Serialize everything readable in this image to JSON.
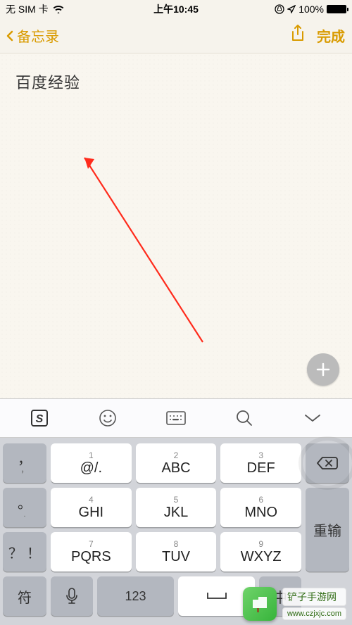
{
  "status": {
    "carrier": "无 SIM 卡",
    "time": "上午10:45",
    "battery": "100%"
  },
  "nav": {
    "back_label": "备忘录",
    "done_label": "完成"
  },
  "note": {
    "content": "百度经验"
  },
  "keyboard": {
    "side_left": {
      "comma": "，",
      "period": "。",
      "question": "？",
      "exclaim": "！"
    },
    "row1": {
      "k1": "@/.",
      "k2": "ABC",
      "k3": "DEF"
    },
    "row2": {
      "k1": "GHI",
      "k2": "JKL",
      "k3": "MNO"
    },
    "row3": {
      "k1": "PQRS",
      "k2": "TUV",
      "k3": "WXYZ"
    },
    "nums": {
      "n1": "1",
      "n2": "2",
      "n3": "3",
      "n4": "4",
      "n5": "5",
      "n6": "6",
      "n7": "7",
      "n8": "8",
      "n9": "9"
    },
    "side_right": {
      "retype": "重输"
    },
    "bottom": {
      "symbol": "符",
      "num123": "123",
      "lang": "中"
    }
  },
  "watermark": {
    "text": "铲子手游网",
    "url": "www.czjxjc.com"
  }
}
